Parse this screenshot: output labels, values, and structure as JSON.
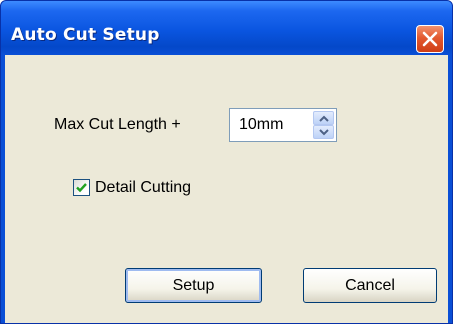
{
  "window": {
    "title": "Auto Cut Setup",
    "close_icon": "close-icon",
    "colors": {
      "titlebar": "#0a55e0",
      "client": "#ece9d8",
      "close": "#e35a30"
    }
  },
  "form": {
    "max_cut_length_label": "Max Cut Length +",
    "max_cut_length_value": "10mm",
    "spin_up_icon": "chevron-up-icon",
    "spin_down_icon": "chevron-down-icon",
    "detail_cutting_label": "Detail Cutting",
    "detail_cutting_checked": true
  },
  "buttons": {
    "setup_label": "Setup",
    "cancel_label": "Cancel"
  }
}
